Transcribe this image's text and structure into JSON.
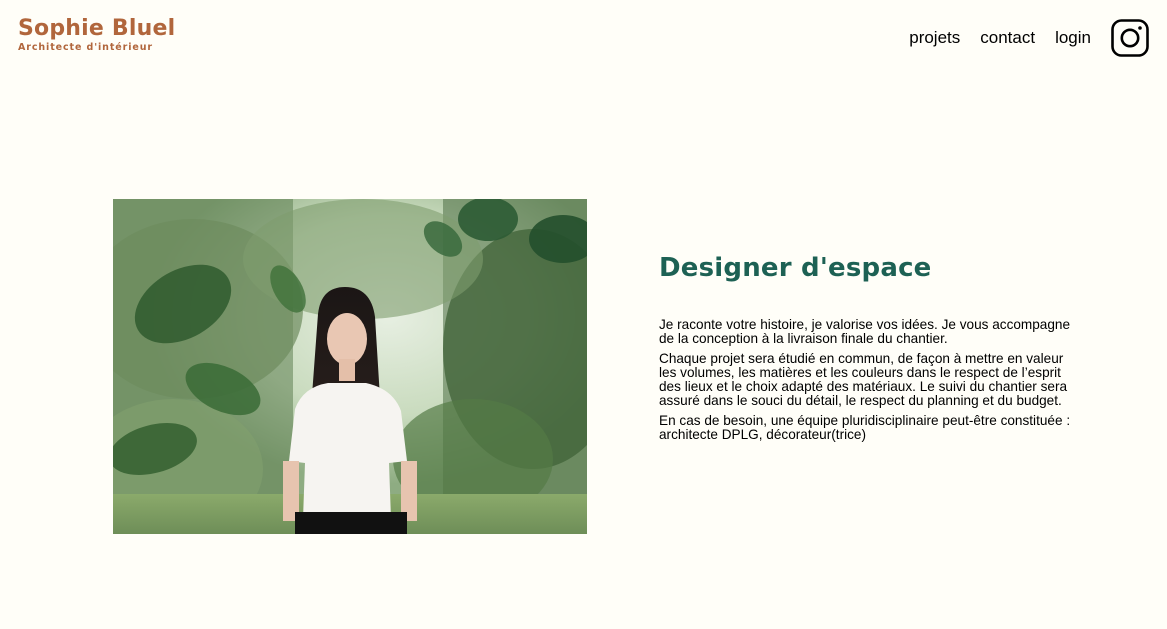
{
  "brand": {
    "name": "Sophie Bluel",
    "subtitle": "Architecte d'intérieur"
  },
  "nav": {
    "items": [
      {
        "label": "projets"
      },
      {
        "label": "contact"
      },
      {
        "label": "login"
      }
    ],
    "instagram_icon": "instagram-icon"
  },
  "introduction": {
    "title": "Designer d'espace",
    "paragraphs": [
      "Je raconte votre histoire, je valorise vos idées. Je vous accompagne de la conception à la livraison finale du chantier.",
      "Chaque projet sera étudié en commun, de façon à mettre en valeur les volumes, les matières et les couleurs dans le respect de l’esprit des lieux et le choix adapté des matériaux. Le suivi du chantier sera assuré dans le souci du détail, le respect du planning et du budget.",
      "En cas de besoin, une équipe pluridisciplinaire peut-être constituée : architecte DPLG, décorateur(trice)"
    ]
  },
  "colors": {
    "background": "#FFFEF8",
    "brand": "#B1663C",
    "title": "#1D6154"
  }
}
